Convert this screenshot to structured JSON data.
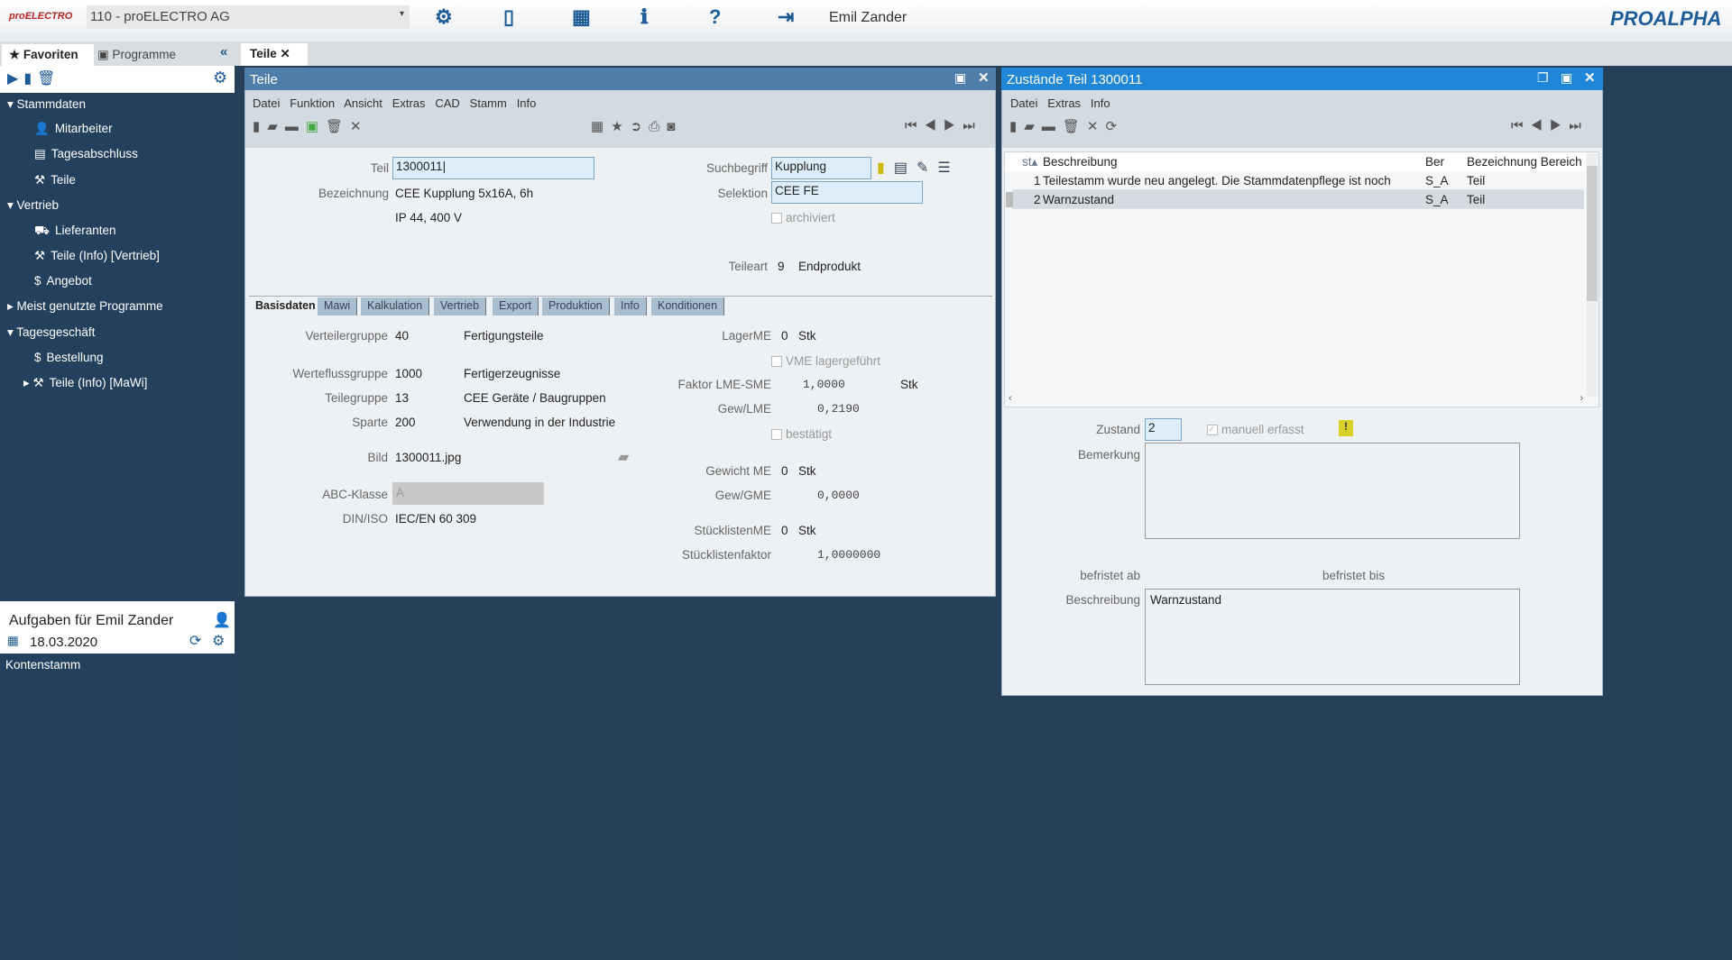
{
  "topbar": {
    "logo": "proELECTRO",
    "company": "110 - proELECTRO AG",
    "user": "Emil Zander",
    "brand": "PROALPHA",
    "icons": [
      "gear-icon",
      "panel-icon",
      "layout-icon",
      "info-icon",
      "help-icon",
      "logout-icon"
    ]
  },
  "sidebar": {
    "tabs": [
      "Favoriten",
      "Programme"
    ],
    "tree": [
      {
        "label": "Stammdaten",
        "level": 0,
        "expanded": true
      },
      {
        "label": "Mitarbeiter",
        "level": 1,
        "icon": "person-icon"
      },
      {
        "label": "Tagesabschluss",
        "level": 1,
        "icon": "calendar-icon"
      },
      {
        "label": "Teile",
        "level": 1,
        "icon": "part-icon"
      },
      {
        "label": "Vertrieb",
        "level": 0,
        "expanded": true
      },
      {
        "label": "Lieferanten",
        "level": 1,
        "icon": "truck-icon"
      },
      {
        "label": "Teile (Info) [Vertrieb]",
        "level": 1,
        "icon": "part-icon"
      },
      {
        "label": "Angebot",
        "level": 1,
        "icon": "offer-icon"
      },
      {
        "label": "Meist genutzte Programme",
        "level": 0,
        "expanded": false
      },
      {
        "label": "Tagesgeschäft",
        "level": 0,
        "expanded": true
      },
      {
        "label": "Bestellung",
        "level": 1,
        "icon": "order-icon"
      },
      {
        "label": "Teile (Info) [MaWi]",
        "level": 1,
        "icon": "part-icon",
        "collapsed": true
      }
    ],
    "tasks": {
      "title": "Aufgaben für Emil Zander",
      "date": "18.03.2020",
      "item": "Kontenstamm"
    }
  },
  "doc_tab": "Teile",
  "teile": {
    "title": "Teile",
    "menu": [
      "Datei",
      "Funktion",
      "Ansicht",
      "Extras",
      "CAD",
      "Stamm",
      "Info"
    ],
    "teil_label": "Teil",
    "teil": "1300011",
    "bez_label": "Bezeichnung",
    "bez1": "CEE Kupplung 5x16A, 6h",
    "bez2": "IP 44, 400 V",
    "such_label": "Suchbegriff",
    "such": "Kupplung",
    "sel_label": "Selektion",
    "sel": "CEE FE",
    "archiviert": "archiviert",
    "teileart_label": "Teileart",
    "teileart_code": "9",
    "teileart": "Endprodukt",
    "tabs": [
      "Basisdaten",
      "Mawi",
      "Kalkulation",
      "Vertrieb",
      "Export",
      "Produktion",
      "Info",
      "Konditionen"
    ],
    "left": [
      {
        "label": "Verteilergruppe",
        "code": "40",
        "text": "Fertigungsteile"
      },
      {
        "label": "Werteflussgruppe",
        "code": "1000",
        "text": "Fertigerzeugnisse"
      },
      {
        "label": "Teilegruppe",
        "code": "13",
        "text": "CEE Geräte / Baugruppen"
      },
      {
        "label": "Sparte",
        "code": "200",
        "text": "Verwendung in der Industrie"
      },
      {
        "label": "Bild",
        "code": "1300011.jpg"
      },
      {
        "label": "ABC-Klasse",
        "code": "A"
      },
      {
        "label": "DIN/ISO",
        "code": "IEC/EN 60 309"
      }
    ],
    "right": {
      "lagerme_label": "LagerME",
      "lagerme": "0",
      "lagerme_unit": "Stk",
      "vme": "VME lagergeführt",
      "faktor_label": "Faktor LME-SME",
      "faktor": "1,0000",
      "faktor_unit": "Stk",
      "gewlme_label": "Gew/LME",
      "gewlme": "0,2190",
      "bestaetigt": "bestätigt",
      "gewme_label": "Gewicht ME",
      "gewme": "0",
      "gewme_unit": "Stk",
      "gewgme_label": "Gew/GME",
      "gewgme": "0,0000",
      "slme_label": "StücklistenME",
      "slme": "0",
      "slme_unit": "Stk",
      "slf_label": "Stücklistenfaktor",
      "slf": "1,0000000"
    }
  },
  "zustaende": {
    "title": "Zustände Teil 1300011",
    "menu": [
      "Datei",
      "Extras",
      "Info"
    ],
    "columns": [
      "st",
      "Beschreibung",
      "Ber",
      "Bezeichnung Bereich"
    ],
    "rows": [
      {
        "st": "1",
        "desc": "Teilestamm wurde neu angelegt. Die Stammdatenpflege ist noch",
        "ber": "S_A",
        "bereich": "Teil"
      },
      {
        "st": "2",
        "desc": "Warnzustand",
        "ber": "S_A",
        "bereich": "Teil",
        "selected": true
      }
    ],
    "zustand_label": "Zustand",
    "zustand": "2",
    "manuell": "manuell erfasst",
    "manuell_checked": true,
    "bem_label": "Bemerkung",
    "bem": "",
    "ab_label": "befristet ab",
    "bis_label": "befristet bis",
    "besch_label": "Beschreibung",
    "besch": "Warnzustand"
  },
  "colors": {
    "accent": "#1d5c96",
    "teile_title": "#4f7eaa",
    "zust_title": "#1f86d8",
    "background": "#27405a"
  }
}
